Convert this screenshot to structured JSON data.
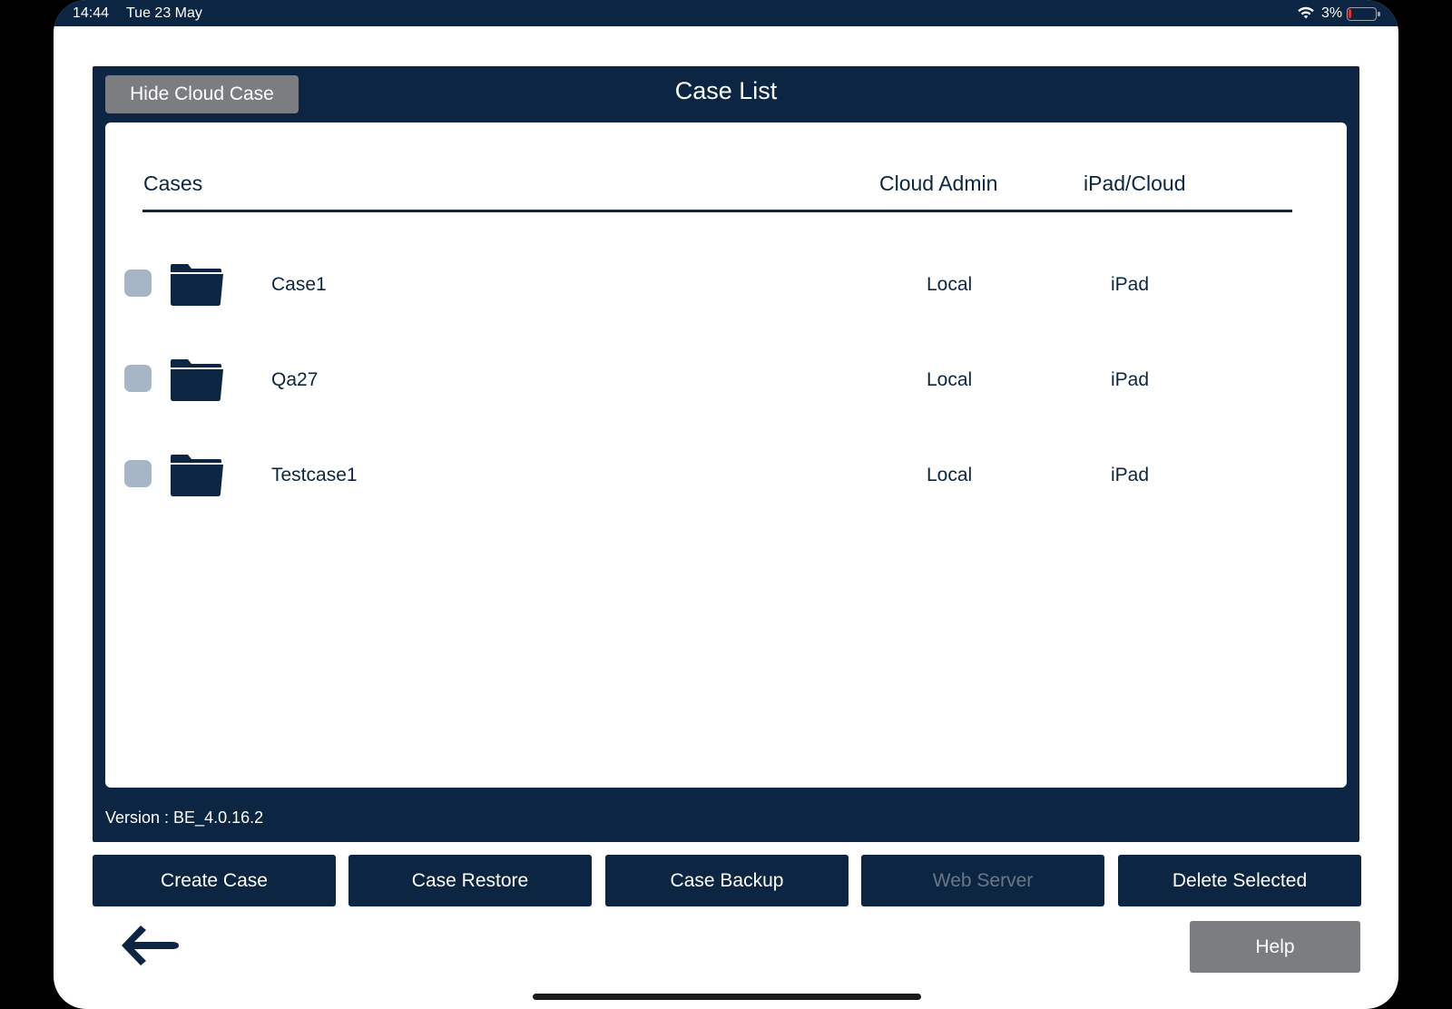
{
  "status_bar": {
    "time": "14:44",
    "date": "Tue 23 May",
    "battery_percent": "3%",
    "battery_level": 0.03,
    "wifi_icon": "wifi-icon",
    "battery_icon": "battery-icon"
  },
  "panel": {
    "title": "Case List",
    "hide_cloud_button": "Hide Cloud Case",
    "version": "Version : BE_4.0.16.2"
  },
  "table": {
    "headers": {
      "cases": "Cases",
      "cloud_admin": "Cloud Admin",
      "ipad_cloud": "iPad/Cloud"
    },
    "rows": [
      {
        "name": "Case1",
        "admin": "Local",
        "location": "iPad",
        "checked": false
      },
      {
        "name": "Qa27",
        "admin": "Local",
        "location": "iPad",
        "checked": false
      },
      {
        "name": "Testcase1",
        "admin": "Local",
        "location": "iPad",
        "checked": false
      }
    ]
  },
  "actions": {
    "create_case": "Create Case",
    "case_restore": "Case Restore",
    "case_backup": "Case Backup",
    "web_server": "Web Server",
    "delete_selected": "Delete Selected"
  },
  "footer": {
    "help": "Help",
    "back_icon": "back-arrow-icon"
  },
  "colors": {
    "navy": "#0b2542",
    "gray_button": "#7b7d80",
    "checkbox": "#a7b6c7",
    "disabled_text": "#6b7787"
  }
}
